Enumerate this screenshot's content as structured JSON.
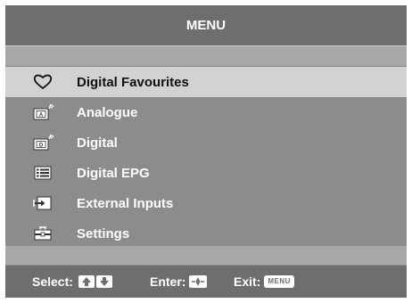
{
  "header": {
    "title": "MENU"
  },
  "menu": {
    "items": [
      {
        "label": "Digital Favourites",
        "icon": "heart-icon",
        "selected": true
      },
      {
        "label": "Analogue",
        "icon": "analogue-tv-icon",
        "selected": false
      },
      {
        "label": "Digital",
        "icon": "digital-tv-icon",
        "selected": false
      },
      {
        "label": "Digital EPG",
        "icon": "epg-guide-icon",
        "selected": false
      },
      {
        "label": "External Inputs",
        "icon": "input-arrow-icon",
        "selected": false
      },
      {
        "label": "Settings",
        "icon": "toolbox-icon",
        "selected": false
      }
    ]
  },
  "footer": {
    "select_label": "Select:",
    "enter_label": "Enter:",
    "exit_label": "Exit:",
    "exit_key": "MENU"
  },
  "colors": {
    "header_bg": "#6e6e6e",
    "menu_bg": "#8c8c8c",
    "band_bg": "#a8a8a8",
    "selected_bg": "#d2d2d2",
    "text_light": "#ffffff",
    "text_dark": "#111111"
  }
}
